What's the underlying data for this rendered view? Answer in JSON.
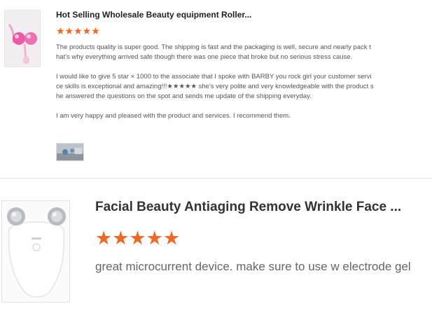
{
  "reviews": [
    {
      "product_title": "Hot Selling Wholesale Beauty equipment Roller...",
      "stars": "★★★★★",
      "rating": 5,
      "paragraphs": [
        "The products quality is super good. The shipping is fast and the packaging is well, secure and nearly pack that's why everything arrived safe though there was one piece that broke but no serious stress cause.",
        "I would like to give 5 star × 1000 to the associate that I spoke with BARBY you rock girl your customer service skills is exceptional and amazing!!!★★★★★ she's very polite and very knowledgeable with the product she answered the questions on the spot and sends me update of the shipping everyday.",
        "I am very happy and pleased with the product and services. I recommend them."
      ]
    },
    {
      "product_title": "Facial Beauty Antiaging Remove Wrinkle Face ...",
      "stars": "★★★★★",
      "rating": 5,
      "text": "great microcurrent device.  make sure to use w electrode gel"
    }
  ],
  "colors": {
    "star": "#f26722",
    "divider": "#e5e5e5"
  }
}
